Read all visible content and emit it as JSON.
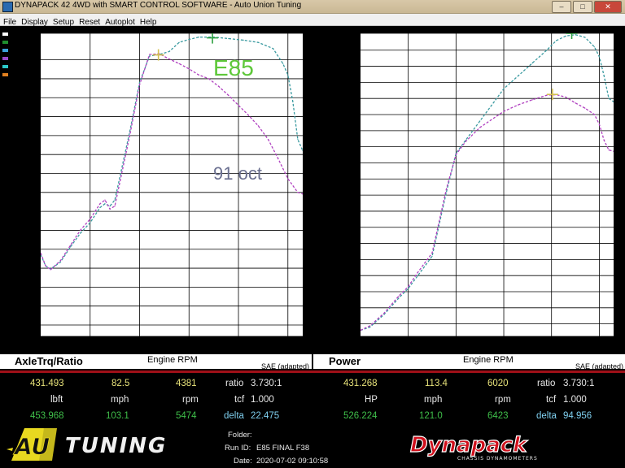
{
  "window": {
    "title": "DYNAPACK 42 4WD with SMART CONTROL SOFTWARE - Auto Union Tuning"
  },
  "menu": [
    "File",
    "Display",
    "Setup",
    "Reset",
    "Autoplot",
    "Help"
  ],
  "legend_colors": [
    "#ffffff",
    "#1f8f2e",
    "#3aa0d8",
    "#9a4ac8",
    "#2bc8c8",
    "#e08020"
  ],
  "left_panel": {
    "title": "AxleTrq/Ratio",
    "xlabel": "Engine RPM",
    "ylabel": "lbft",
    "sae": "SAE (adapted)"
  },
  "right_panel": {
    "title": "Power",
    "xlabel": "Engine RPM",
    "ylabel": "HP",
    "sae": "SAE (adapted)"
  },
  "annotations": {
    "e85": "E85",
    "oct91": "91 oct"
  },
  "readouts_left": {
    "row1": {
      "trq": "431.493",
      "mph": "82.5",
      "rpm": "4381",
      "ratio_label": "ratio",
      "ratio": "3.730:1"
    },
    "row2": {
      "unit_trq": "lbft",
      "unit_mph": "mph",
      "unit_rpm": "rpm",
      "tcf_label": "tcf",
      "tcf": "1.000"
    },
    "row3": {
      "trq": "453.968",
      "mph": "103.1",
      "rpm": "5474",
      "delta_label": "delta",
      "delta": "22.475"
    }
  },
  "readouts_right": {
    "row1": {
      "hp": "431.268",
      "mph": "113.4",
      "rpm": "6020",
      "ratio_label": "ratio",
      "ratio": "3.730:1"
    },
    "row2": {
      "unit_hp": "HP",
      "unit_mph": "mph",
      "unit_rpm": "rpm",
      "tcf_label": "tcf",
      "tcf": "1.000"
    },
    "row3": {
      "hp": "526.224",
      "mph": "121.0",
      "rpm": "6423",
      "delta_label": "delta",
      "delta": "94.956"
    }
  },
  "info": {
    "folder_label": "Folder:",
    "runid_label": "Run ID:",
    "runid": "E85 FINAL F38",
    "date_label": "Date:",
    "date": "2020-07-02 09:10:58"
  },
  "logos": {
    "au": "AU",
    "tuning": "TUNING",
    "dynapack": "Dynapack",
    "dynapack_sub": "CHASSIS DYNAMOMETERS"
  },
  "chart_data": [
    {
      "type": "line",
      "title": "AxleTrq/Ratio",
      "xlabel": "Engine RPM",
      "ylabel": "lbft",
      "xlim": [
        2000,
        7300
      ],
      "ylim": [
        60,
        460
      ],
      "xticks": [
        2000,
        3000,
        4000,
        5000,
        6000,
        7000
      ],
      "yticks": [
        60,
        75,
        100,
        125,
        150,
        175,
        200,
        225,
        250,
        275,
        300,
        325,
        350,
        375,
        400,
        425,
        460
      ],
      "series": [
        {
          "name": "E85",
          "color": "#3a9aa0",
          "x": [
            2000,
            2100,
            2200,
            2400,
            2600,
            2800,
            3000,
            3200,
            3300,
            3400,
            3500,
            3800,
            4000,
            4200,
            4400,
            4600,
            4800,
            5000,
            5200,
            5500,
            5800,
            6100,
            6400,
            6700,
            6900,
            7000,
            7100,
            7200,
            7300
          ],
          "y": [
            168,
            153,
            149,
            158,
            178,
            196,
            210,
            230,
            235,
            232,
            240,
            330,
            395,
            430,
            432,
            436,
            448,
            452,
            455,
            455,
            453,
            451,
            448,
            440,
            420,
            405,
            370,
            320,
            305
          ]
        },
        {
          "name": "91 oct",
          "color": "#b040c0",
          "x": [
            2000,
            2100,
            2200,
            2400,
            2600,
            2800,
            3000,
            3200,
            3300,
            3400,
            3500,
            3800,
            4000,
            4200,
            4400,
            4600,
            4800,
            5000,
            5200,
            5400,
            5600,
            5800,
            6000,
            6200,
            6400,
            6600,
            6800,
            7000,
            7200,
            7300
          ],
          "y": [
            170,
            153,
            148,
            160,
            180,
            200,
            215,
            235,
            240,
            228,
            232,
            325,
            392,
            432,
            433,
            426,
            420,
            413,
            405,
            400,
            390,
            378,
            365,
            352,
            338,
            320,
            295,
            268,
            250,
            248
          ]
        }
      ],
      "markers": [
        {
          "x": 4381,
          "y": 431.5,
          "color": "#d4c050"
        },
        {
          "x": 5474,
          "y": 454,
          "color": "#2ea040"
        }
      ]
    },
    {
      "type": "line",
      "title": "Power",
      "xlabel": "Engine RPM",
      "ylabel": "HP",
      "xlim": [
        2000,
        7300
      ],
      "ylim": [
        55.6,
        526.2
      ],
      "xticks": [
        2000,
        3000,
        4000,
        5000,
        6000,
        7000
      ],
      "yticks": [
        55.6,
        75.0,
        100.0,
        125.0,
        150.0,
        175.0,
        200.0,
        225.0,
        250.0,
        275.0,
        300.0,
        325.0,
        350.0,
        375.0,
        400.0,
        425.0,
        450.0,
        475.0,
        500.0,
        526.2
      ],
      "series": [
        {
          "name": "E85",
          "color": "#3a9aa0",
          "x": [
            2000,
            2200,
            2500,
            2800,
            3000,
            3200,
            3500,
            3800,
            4000,
            4200,
            4500,
            4800,
            5000,
            5300,
            5600,
            5900,
            6100,
            6300,
            6500,
            6700,
            6900,
            7000,
            7100,
            7200,
            7300
          ],
          "y": [
            65,
            70,
            90,
            115,
            130,
            150,
            180,
            280,
            340,
            360,
            390,
            420,
            440,
            460,
            480,
            500,
            515,
            522,
            524,
            520,
            505,
            490,
            460,
            425,
            420
          ]
        },
        {
          "name": "91 oct",
          "color": "#b040c0",
          "x": [
            2000,
            2200,
            2500,
            2800,
            3000,
            3200,
            3500,
            3800,
            4000,
            4200,
            4500,
            4800,
            5000,
            5300,
            5600,
            5900,
            6100,
            6300,
            6500,
            6700,
            6900,
            7000,
            7100,
            7200,
            7300
          ],
          "y": [
            65,
            72,
            92,
            118,
            133,
            155,
            185,
            285,
            338,
            358,
            380,
            395,
            405,
            415,
            423,
            430,
            431,
            427,
            418,
            410,
            400,
            385,
            360,
            345,
            343
          ]
        }
      ],
      "markers": [
        {
          "x": 6020,
          "y": 431.3,
          "color": "#d4c050"
        },
        {
          "x": 6423,
          "y": 526.2,
          "color": "#2ea040"
        }
      ]
    }
  ]
}
